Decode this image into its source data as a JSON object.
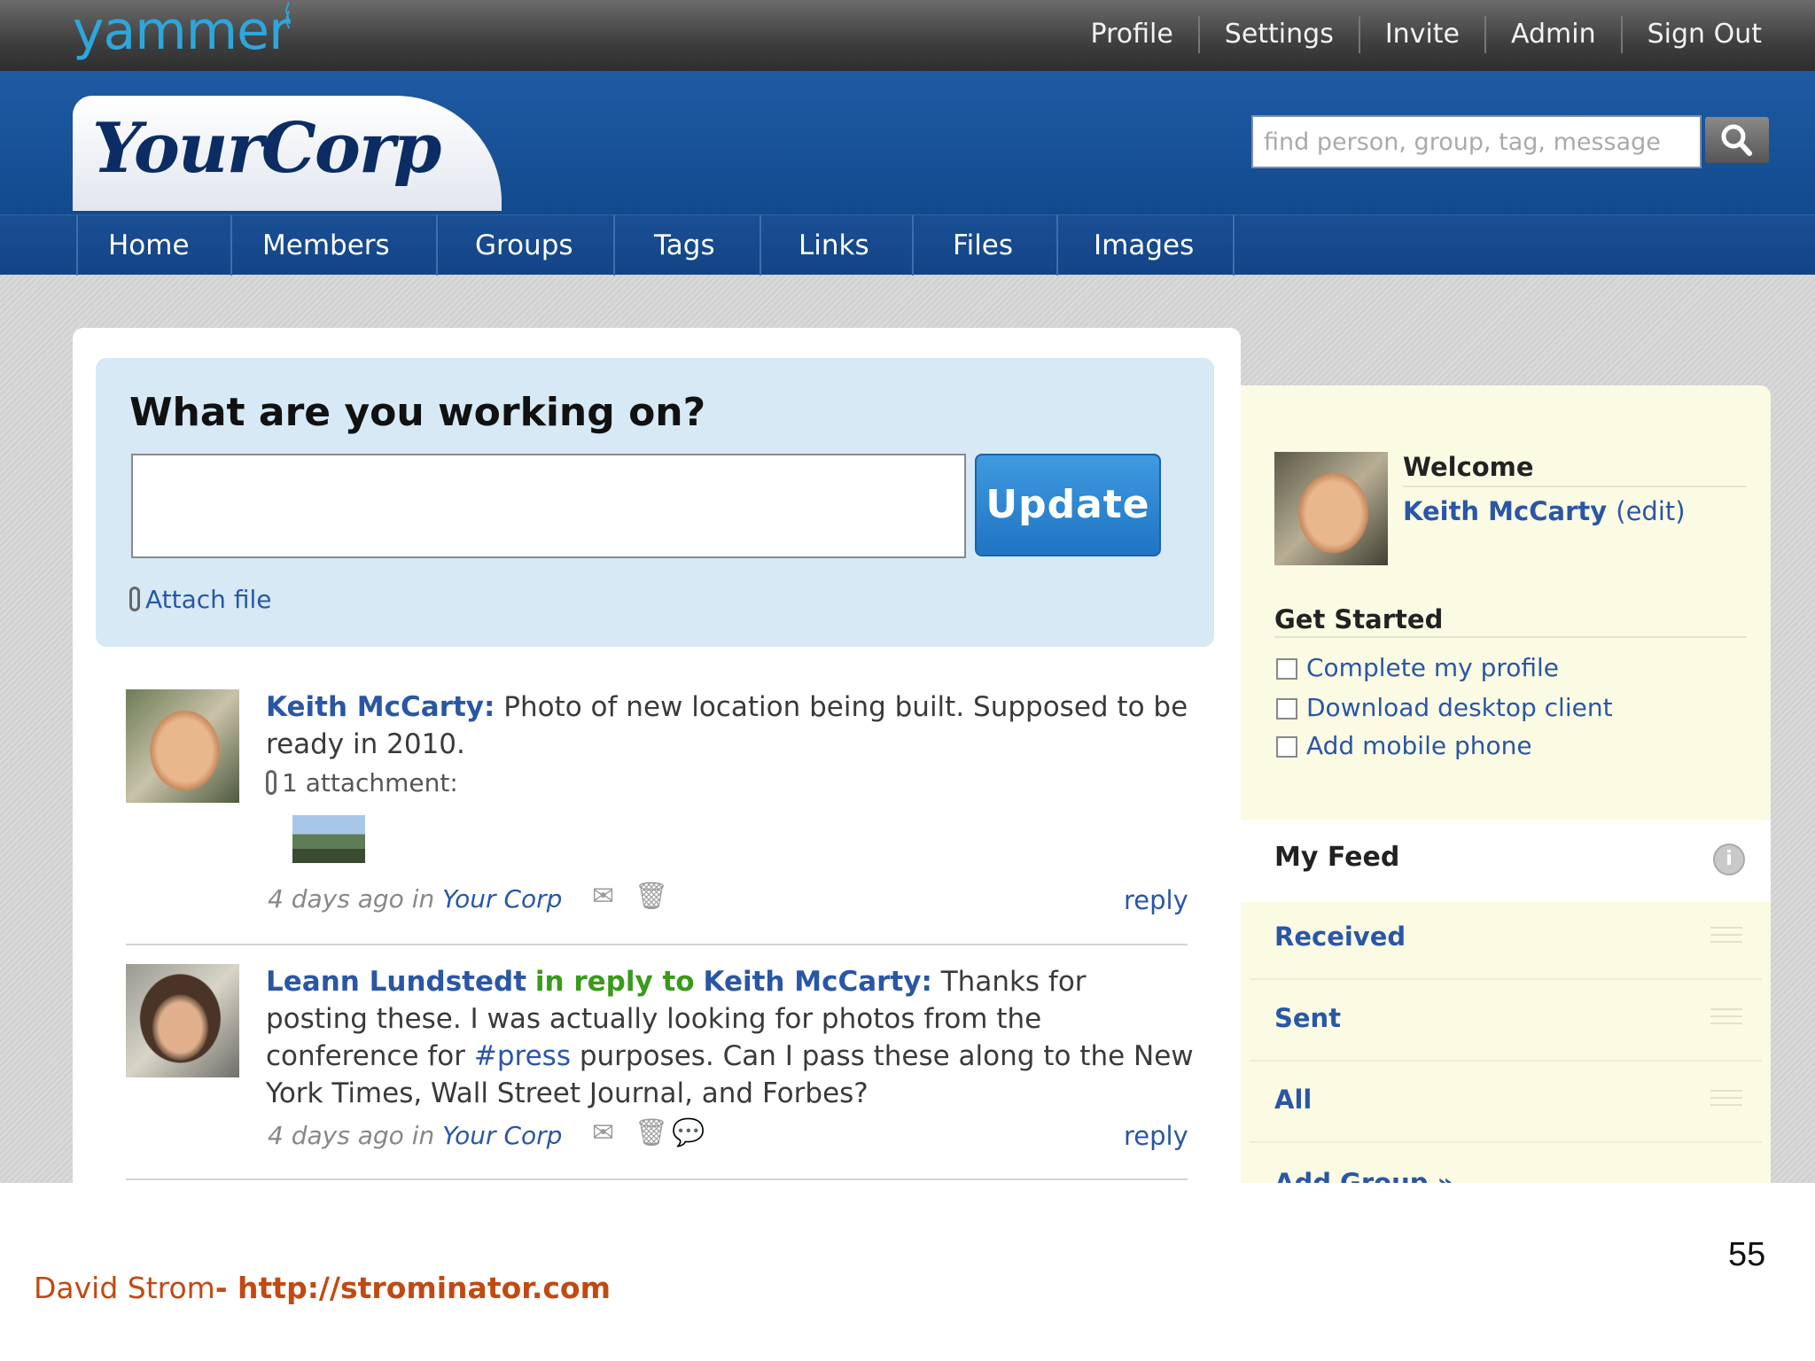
{
  "topbar": {
    "logo": "yammer",
    "links": [
      "Profile",
      "Settings",
      "Invite",
      "Admin",
      "Sign Out"
    ]
  },
  "header": {
    "network_name": "YourCorp",
    "search": {
      "placeholder": "find person, group, tag, message",
      "icon": "search-icon"
    }
  },
  "nav": {
    "items": [
      "Home",
      "Members",
      "Groups",
      "Tags",
      "Links",
      "Files",
      "Images"
    ]
  },
  "composer": {
    "prompt": "What are you working on?",
    "update_label": "Update",
    "attach_label": "Attach file"
  },
  "posts": [
    {
      "author": "Keith McCarty:",
      "text": " Photo of new location being built. Supposed to be ready in 2010.",
      "attachment_label": "1 attachment:",
      "time": "4 days ago",
      "in_label": "in",
      "group": "Your Corp",
      "reply_label": "reply"
    },
    {
      "author": "Leann Lundstedt",
      "in_reply_to": "in reply to",
      "reply_target": "Keith McCarty:",
      "text_before_tag": " Thanks for posting these. I was actually looking for photos from the conference for ",
      "hashtag": "#press",
      "text_after_tag": " purposes. Can I pass these along to the New York Times, Wall Street Journal, and Forbes?",
      "time": "4 days ago",
      "in_label": "in",
      "group": "Your Corp",
      "reply_label": "reply"
    }
  ],
  "sidebar": {
    "welcome": "Welcome",
    "user_name": "Keith McCarty",
    "edit_label": "(edit)",
    "get_started": "Get Started",
    "tasks": [
      "Complete my profile",
      "Download desktop client",
      "Add mobile phone"
    ],
    "my_feed": "My Feed",
    "feeds": [
      "Received",
      "Sent",
      "All"
    ],
    "add_group": "Add Group"
  },
  "slide": {
    "page_number": "55",
    "credit_name": "David Strom",
    "credit_url": "- http://strominator.com"
  }
}
